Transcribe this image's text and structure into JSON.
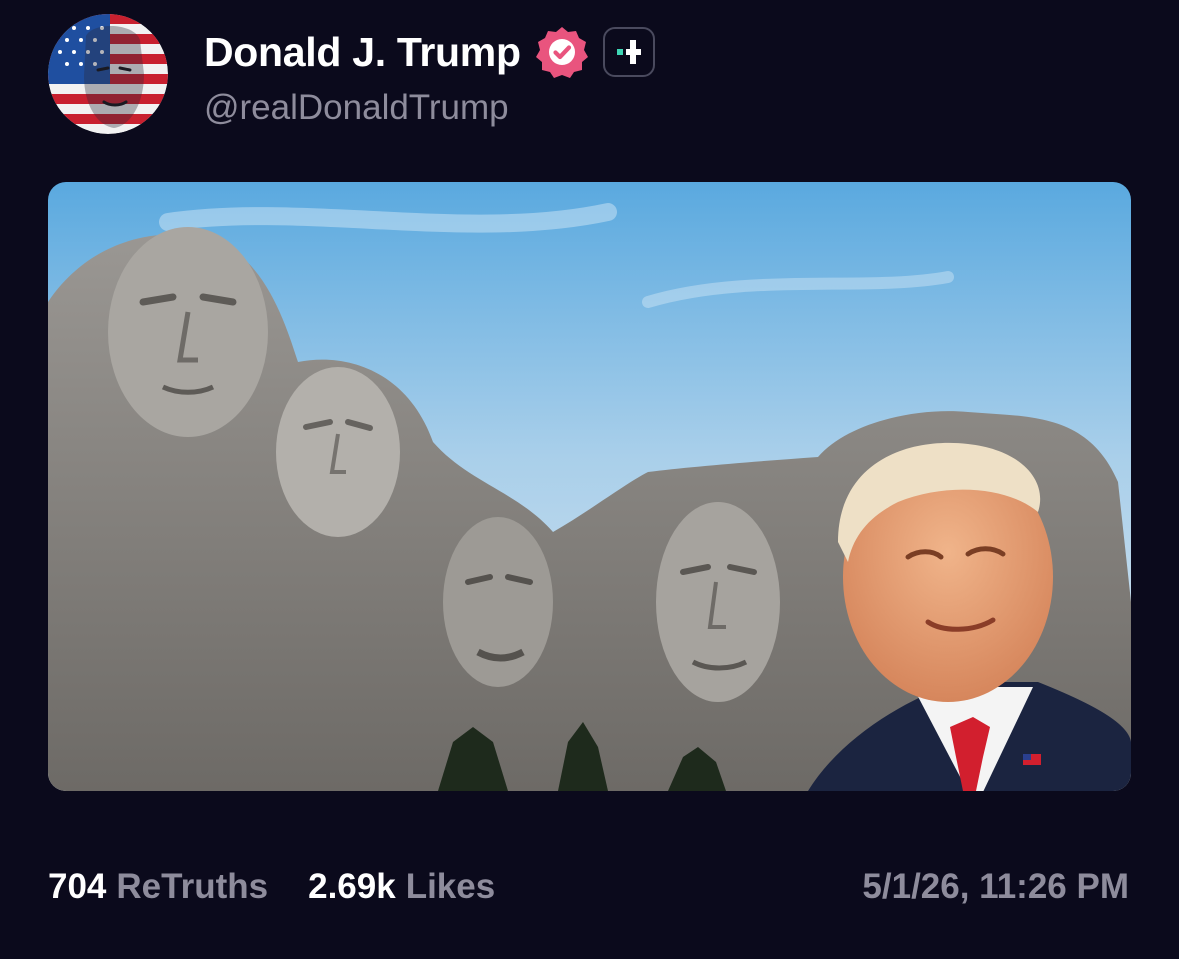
{
  "author": {
    "display_name": "Donald J. Trump",
    "handle": "@realDonaldTrump",
    "verified_icon": "verified-badge-icon",
    "plus_icon": "truth-plus-icon",
    "avatar_icon": "avatar-image"
  },
  "media": {
    "image_icon": "post-image"
  },
  "stats": {
    "retruths_count": "704",
    "retruths_label": "ReTruths",
    "likes_count": "2.69k",
    "likes_label": "Likes"
  },
  "timestamp": "5/1/26, 11:26 PM",
  "colors": {
    "background": "#0b0a1c",
    "text_primary": "#ffffff",
    "text_secondary": "#8e8c9c",
    "verified_badge": "#e9547e",
    "plus_accent": "#3ed6b5"
  }
}
